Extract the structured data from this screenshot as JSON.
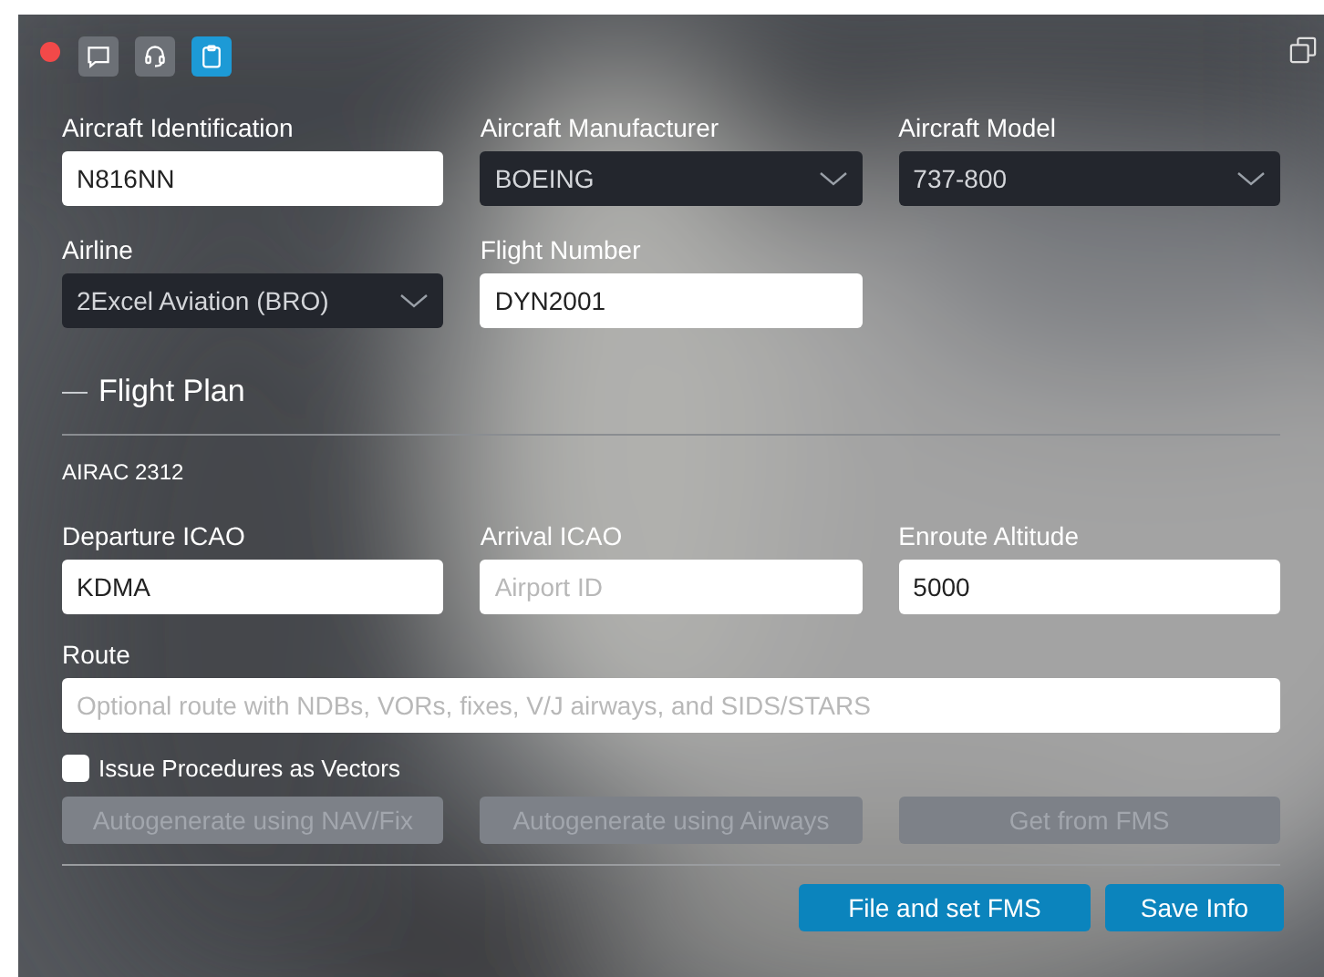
{
  "tabs": [
    {
      "selected": false
    },
    {
      "selected": false
    },
    {
      "selected": true
    }
  ],
  "aircraft_fields": [
    {
      "label": "Aircraft Identification",
      "kind": "text",
      "value": "N816NN"
    },
    {
      "label": "Aircraft Manufacturer",
      "kind": "select",
      "value": "BOEING"
    },
    {
      "label": "Aircraft Model",
      "kind": "select",
      "value": "737-800"
    },
    {
      "label": "Airline",
      "kind": "select",
      "value": "2Excel Aviation (BRO)"
    },
    {
      "label": "Flight Number",
      "kind": "text",
      "value": "DYN2001"
    }
  ],
  "section": {
    "toggle": "—",
    "title": "Flight Plan",
    "airac": "AIRAC 2312"
  },
  "plan_fields": [
    {
      "label": "Departure ICAO",
      "kind": "text",
      "value": "KDMA"
    },
    {
      "label": "Arrival ICAO",
      "kind": "text",
      "placeholder": "Airport ID"
    },
    {
      "label": "Enroute Altitude",
      "kind": "text",
      "value": "5000"
    }
  ],
  "route": {
    "label": "Route",
    "placeholder": "Optional route with NDBs, VORs, fixes, V/J airways, and SIDS/STARS"
  },
  "vectors": {
    "label": "Issue Procedures as Vectors",
    "checked": false
  },
  "route_buttons": [
    {
      "label": "Autogenerate using NAV/Fix",
      "disabled": true
    },
    {
      "label": "Autogenerate using Airways",
      "disabled": true
    },
    {
      "label": "Get from FMS",
      "disabled": true
    }
  ],
  "actions": [
    "File and set FMS",
    "Save Info"
  ]
}
